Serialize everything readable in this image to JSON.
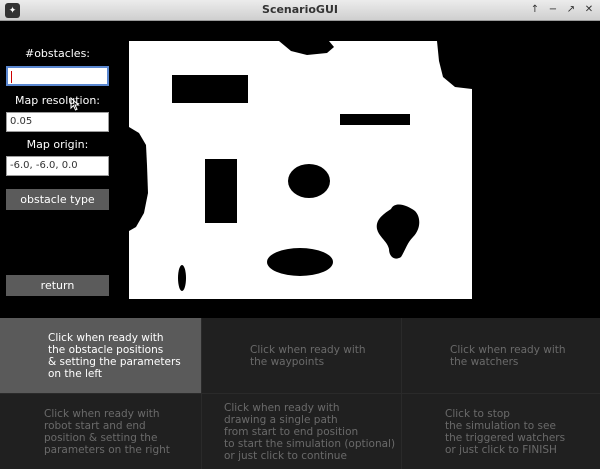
{
  "window": {
    "title": "ScenarioGUI",
    "controls": [
      "↑",
      "−",
      "↗",
      "✕"
    ]
  },
  "sidebar": {
    "obstacles_label": "#obstacles:",
    "obstacles_value": "",
    "resolution_label": "Map resolution:",
    "resolution_value": "0.05",
    "origin_label": "Map origin:",
    "origin_value": "-6.0, -6.0, 0.0",
    "obstacle_type_button": "obstacle type",
    "return_button": "return"
  },
  "steps": [
    {
      "text": "Click when ready with\nthe obstacle positions\n& setting the parameters\non the left",
      "active": true
    },
    {
      "text": "Click when ready with\nthe waypoints",
      "active": false
    },
    {
      "text": "Click when ready with\nthe watchers",
      "active": false
    },
    {
      "text": "Click when ready with\nrobot start and end\nposition & setting the\nparameters on the right",
      "active": false
    },
    {
      "text": "Click when ready with\ndrawing a single path\nfrom start to end position\nto start the simulation (optional)\nor just click to continue",
      "active": false
    },
    {
      "text": "Click to stop\nthe simulation to see\nthe triggered watchers\nor just click to FINISH",
      "active": false
    }
  ],
  "colors": {
    "background": "#000000",
    "map_free": "#ffffff",
    "active_step": "#5a5a5a",
    "inactive_step": "#202020"
  }
}
